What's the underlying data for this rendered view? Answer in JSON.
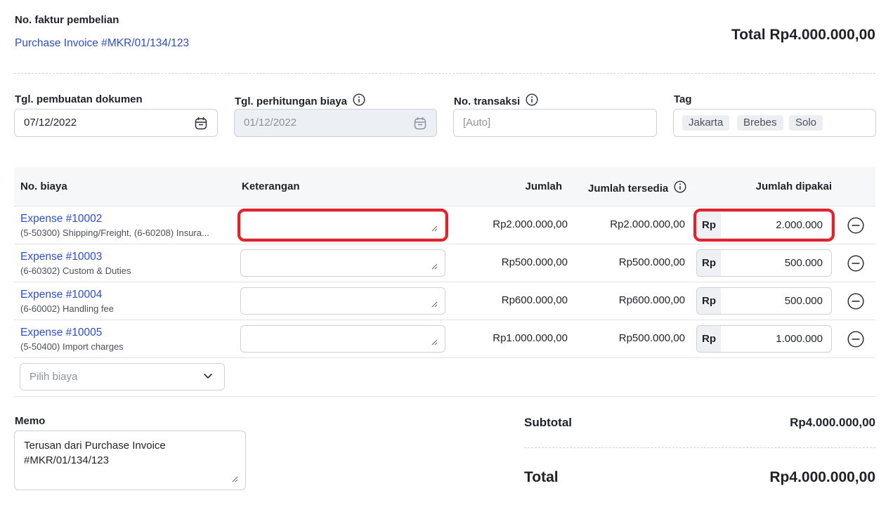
{
  "header": {
    "invoice_label": "No. faktur pembelian",
    "invoice_link": "Purchase Invoice #MKR/01/134/123",
    "total_label": "Total Rp4.000.000,00"
  },
  "fields": {
    "doc_date_label": "Tgl. pembuatan dokumen",
    "doc_date_value": "07/12/2022",
    "cost_date_label": "Tgl. perhitungan biaya",
    "cost_date_value": "01/12/2022",
    "trx_label": "No. transaksi",
    "trx_placeholder": "[Auto]",
    "tag_label": "Tag",
    "tags": [
      "Jakarta",
      "Brebes",
      "Solo"
    ]
  },
  "table": {
    "headers": {
      "no_biaya": "No. biaya",
      "keterangan": "Keterangan",
      "jumlah": "Jumlah",
      "jumlah_tersedia": "Jumlah tersedia",
      "jumlah_dipakai": "Jumlah dipakai"
    },
    "currency_prefix": "Rp",
    "rows": [
      {
        "expense": "Expense #10002",
        "account": "(5-50300) Shipping/Freight, (6-60208) Insura...",
        "jumlah": "Rp2.000.000,00",
        "tersedia": "Rp2.000.000,00",
        "dipakai": "2.000.000"
      },
      {
        "expense": "Expense #10003",
        "account": "(6-60302) Custom & Duties",
        "jumlah": "Rp500.000,00",
        "tersedia": "Rp500.000,00",
        "dipakai": "500.000"
      },
      {
        "expense": "Expense #10004",
        "account": "(6-60002) Handling fee",
        "jumlah": "Rp600.000,00",
        "tersedia": "Rp600.000,00",
        "dipakai": "500.000"
      },
      {
        "expense": "Expense #10005",
        "account": "(5-50400) Import charges",
        "jumlah": "Rp1.000.000,00",
        "tersedia": "Rp500.000,00",
        "dipakai": "1.000.000"
      }
    ],
    "select_placeholder": "Pilih biaya"
  },
  "memo": {
    "label": "Memo",
    "text": "Terusan dari Purchase Invoice #MKR/01/134/123"
  },
  "summary": {
    "subtotal_label": "Subtotal",
    "subtotal_value": "Rp4.000.000,00",
    "total_label": "Total",
    "total_value": "Rp4.000.000,00"
  },
  "colors": {
    "link": "#2d4ec9",
    "highlight": "#e3212a"
  }
}
